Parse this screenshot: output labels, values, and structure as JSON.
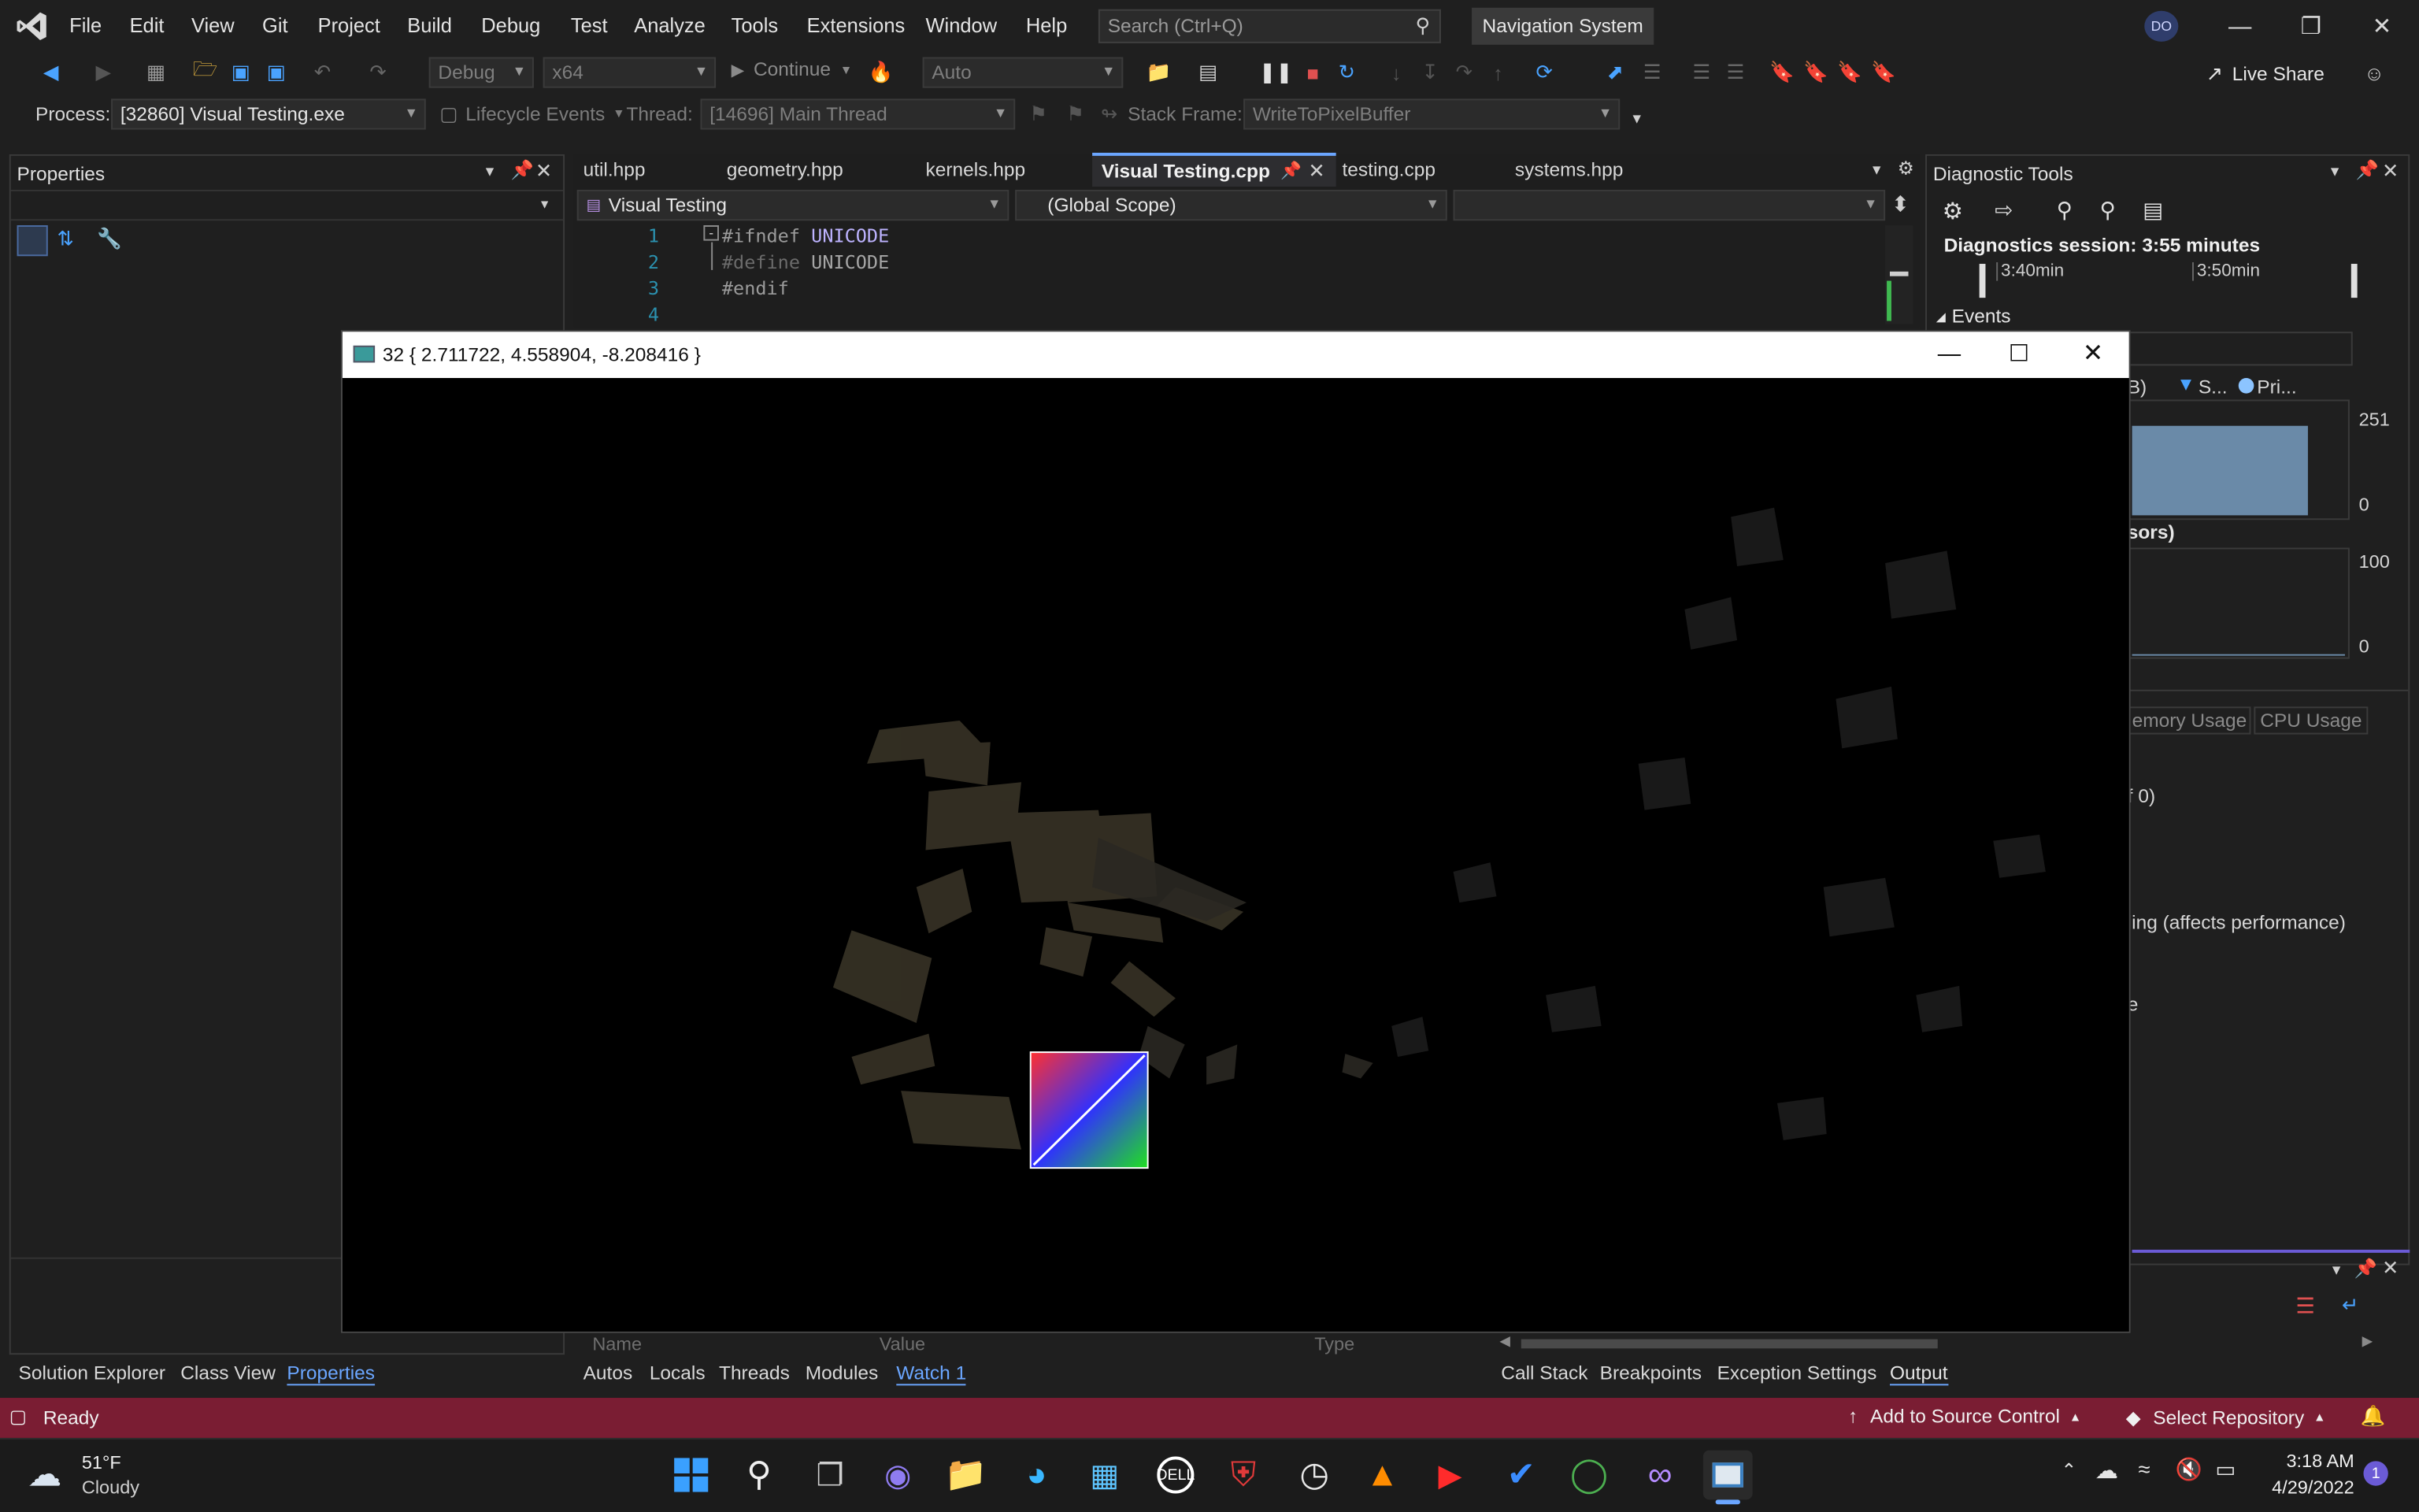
{
  "menu": {
    "items": [
      "File",
      "Edit",
      "View",
      "Git",
      "Project",
      "Build",
      "Debug",
      "Test",
      "Analyze",
      "Tools",
      "Extensions",
      "Window",
      "Help"
    ],
    "search_placeholder": "Search (Ctrl+Q)",
    "solution_name": "Navigation System",
    "account_initials": "DO"
  },
  "toolbar": {
    "config": "Debug",
    "platform": "x64",
    "continue_label": "Continue",
    "auto_label": "Auto",
    "live_share": "Live Share"
  },
  "debug_location": {
    "process_label": "Process:",
    "process_value": "[32860] Visual Testing.exe",
    "lifecycle_label": "Lifecycle Events",
    "thread_label": "Thread:",
    "thread_value": "[14696] Main Thread",
    "stack_frame_label": "Stack Frame:",
    "stack_frame_value": "WriteToPixelBuffer"
  },
  "properties_panel": {
    "title": "Properties",
    "bottom_tabs": [
      "Solution Explorer",
      "Class View",
      "Properties"
    ]
  },
  "editor": {
    "tabs": [
      "util.hpp",
      "geometry.hpp",
      "kernels.hpp",
      "Visual Testing.cpp",
      "testing.cpp",
      "systems.hpp"
    ],
    "active_tab": "Visual Testing.cpp",
    "project_dropdown": "Visual Testing",
    "scope_dropdown": "(Global Scope)",
    "line_numbers": [
      "1",
      "2",
      "3",
      "4"
    ],
    "lines": [
      {
        "kw": "#ifndef",
        "id": "UNICODE"
      },
      {
        "kw": "#define",
        "id": "UNICODE"
      },
      {
        "kw": "#endif",
        "id": ""
      }
    ]
  },
  "diagnostics": {
    "title": "Diagnostic Tools",
    "session": "Diagnostics session: 3:55 minutes",
    "timeline_ticks": [
      "3:40min",
      "3:50min"
    ],
    "events_label": "Events",
    "legend_partial": "B)",
    "legend_s": "S...",
    "legend_pri": "Pri...",
    "mem_max": "251",
    "mem_min": "0",
    "cpu_label_partial": "sors)",
    "cpu_max": "100",
    "cpu_min": "0",
    "tabs_partial": [
      "emory Usage",
      "CPU Usage"
    ],
    "row_partial_1": "f 0)",
    "row_partial_2": "ling (affects performance)",
    "row_partial_3": "e"
  },
  "watch": {
    "headers": [
      "Name",
      "Value",
      "Type"
    ],
    "tabs": [
      "Autos",
      "Locals",
      "Threads",
      "Modules",
      "Watch 1"
    ],
    "active_tab": "Watch 1"
  },
  "output_tabs": [
    "Call Stack",
    "Breakpoints",
    "Exception Settings",
    "Output"
  ],
  "app_window": {
    "title": "32 { 2.711722, 4.558904, -8.208416 }"
  },
  "statusbar": {
    "ready": "Ready",
    "source_control": "Add to Source Control",
    "repository": "Select Repository",
    "notifications": "1"
  },
  "taskbar": {
    "weather_temp": "51°F",
    "weather_desc": "Cloudy",
    "time": "3:18 AM",
    "date": "4/29/2022",
    "notification_count": "1"
  },
  "colors": {
    "accent": "#7a1d33",
    "editor_keyword": "#9b9b9b",
    "editor_identifier": "#bdb3ff",
    "line_number": "#2b91af"
  }
}
